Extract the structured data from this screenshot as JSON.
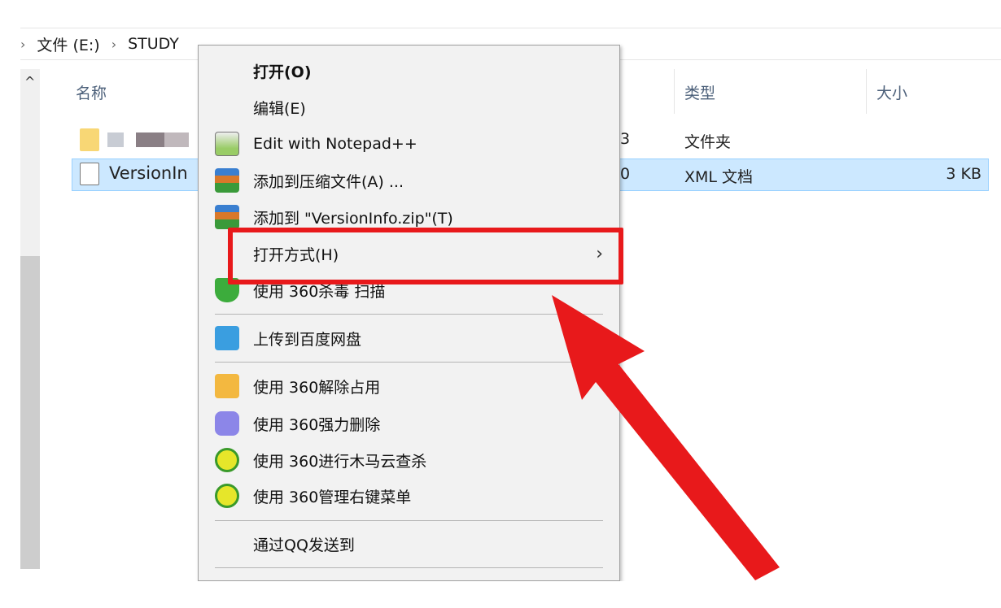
{
  "breadcrumb": {
    "items": [
      "文件 (E:)",
      "STUDY"
    ]
  },
  "columns": {
    "name": "名称",
    "type": "类型",
    "size": "大小"
  },
  "files": [
    {
      "name": "",
      "date_fragment": "3",
      "type": "文件夹",
      "size": ""
    },
    {
      "name": "VersionIn",
      "date_fragment": "0",
      "type": "XML 文档",
      "size": "3 KB",
      "selected": true
    }
  ],
  "menu": {
    "items": [
      {
        "label": "打开(O)",
        "icon": "none",
        "bold": true
      },
      {
        "label": "编辑(E)",
        "icon": "none"
      },
      {
        "label": "Edit with Notepad++",
        "icon": "notepadpp-icon"
      },
      {
        "label": "添加到压缩文件(A) ...",
        "icon": "winrar-icon"
      },
      {
        "label": "添加到 \"VersionInfo.zip\"(T)",
        "icon": "winrar-icon"
      },
      {
        "label": "打开方式(H)",
        "icon": "none",
        "submenu": true,
        "highlighted": true
      },
      {
        "label": "使用 360杀毒 扫描",
        "icon": "360-shield-icon"
      },
      {
        "label": "上传到百度网盘",
        "icon": "baidu-netdisk-icon"
      },
      {
        "label": "使用 360解除占用",
        "icon": "360-unlock-icon"
      },
      {
        "label": "使用 360强力删除",
        "icon": "360-shred-icon"
      },
      {
        "label": "使用 360进行木马云查杀",
        "icon": "360-safe-icon"
      },
      {
        "label": "使用 360管理右键菜单",
        "icon": "360-safe-icon"
      },
      {
        "label": "通过QQ发送到",
        "icon": "none"
      }
    ]
  },
  "annotation_color": "#e8191b"
}
